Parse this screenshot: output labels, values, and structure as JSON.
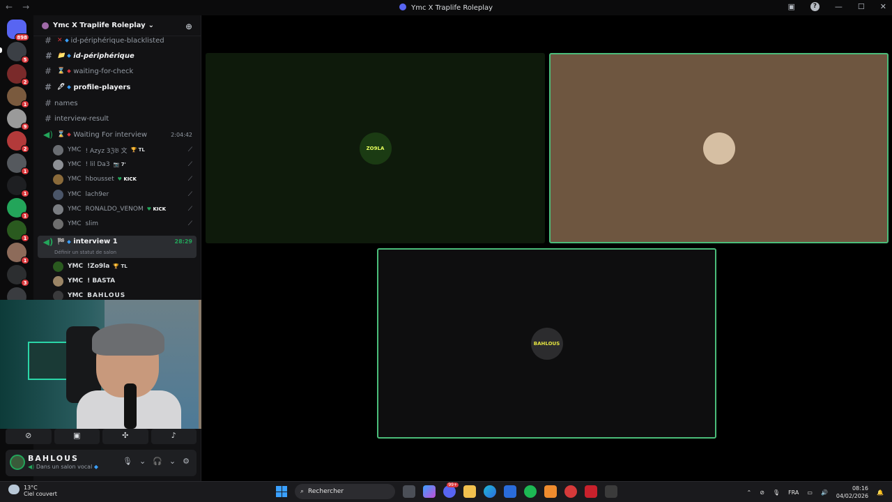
{
  "window": {
    "title": "Ymc X Traplife Roleplay",
    "nav_back": "←",
    "nav_forward": "→"
  },
  "guilds": {
    "home_badge": "898",
    "badges": [
      "5",
      "2",
      "1",
      "9",
      "2",
      "1",
      "1",
      "1",
      "1",
      "1",
      "3"
    ]
  },
  "server": {
    "name": "Ymc X Traplife Roleplay",
    "chevron": "⌄"
  },
  "channels": [
    {
      "emoji": "✕",
      "name": "id-périphérique-blacklisted"
    },
    {
      "emoji": "📁",
      "name": "id-périphérique"
    },
    {
      "emoji": "⌛",
      "name": "waiting-for-check"
    },
    {
      "emoji": "🖊",
      "name": "profile-players"
    },
    {
      "emoji": "",
      "name": "names"
    },
    {
      "emoji": "",
      "name": "interview-result"
    }
  ],
  "voice_waiting": {
    "name": "Waiting For interview",
    "timer": "2:04:42",
    "members": [
      {
        "prefix": "YMC",
        "name": "! Azyz 3ℨ𝔅 文",
        "tag": "🏆 TL"
      },
      {
        "prefix": "YMC",
        "name": "! lil Da3",
        "tag": "📷 7'"
      },
      {
        "prefix": "YMC",
        "name": "hbousset",
        "tag": "KICK"
      },
      {
        "prefix": "YMC",
        "name": "lach9er",
        "tag": ""
      },
      {
        "prefix": "YMC",
        "name": "RONALDO_VENOM",
        "tag": "KICK"
      },
      {
        "prefix": "YMC",
        "name": "slim",
        "tag": ""
      }
    ]
  },
  "voice_active": {
    "name": "interview 1",
    "timer": "28:29",
    "status_hint": "Définir un statut de salon",
    "members": [
      {
        "prefix": "YMC",
        "name": "!Zo9la",
        "tag": "🏆 TL"
      },
      {
        "prefix": "YMC",
        "name": "! BASTA",
        "tag": ""
      },
      {
        "prefix": "YMC",
        "name": "BAHLOUS",
        "tag": ""
      }
    ]
  },
  "stage": {
    "tiles": [
      {
        "label": "ZO9LA"
      },
      {
        "label": ""
      },
      {
        "label": "BAHLOUS"
      }
    ]
  },
  "user_panel": {
    "username": "BAHLOUS",
    "status": "Dans un salon vocal"
  },
  "taskbar": {
    "temperature": "13°C",
    "weather": "Ciel couvert",
    "search_label": "Rechercher",
    "discord_badge": "99+",
    "language": "FRA",
    "time": "08:16",
    "date": "04/02/2026"
  }
}
